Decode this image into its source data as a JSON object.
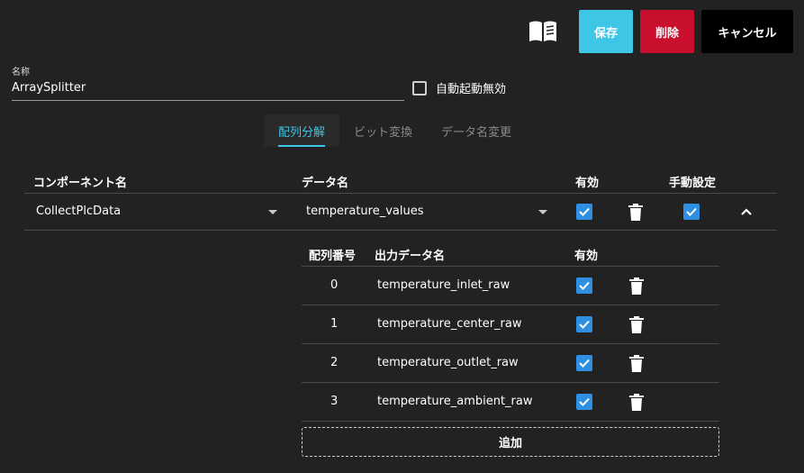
{
  "toolbar": {
    "manual_icon": "book-icon",
    "save_label": "保存",
    "delete_label": "削除",
    "cancel_label": "キャンセル"
  },
  "form": {
    "name_label": "名称",
    "name_value": "ArraySplitter",
    "autostart_label": "自動起動無効",
    "autostart_checked": false
  },
  "tabs": [
    {
      "label": "配列分解",
      "active": true
    },
    {
      "label": "ビット変換",
      "active": false
    },
    {
      "label": "データ名変更",
      "active": false
    }
  ],
  "table": {
    "headers": {
      "component": "コンポーネント名",
      "data": "データ名",
      "enabled": "有効",
      "manual": "手動設定"
    },
    "row": {
      "component": "CollectPlcData",
      "data": "temperature_values",
      "enabled": true,
      "manual": true,
      "expanded": true
    }
  },
  "subtable": {
    "headers": {
      "index": "配列番号",
      "output": "出力データ名",
      "enabled": "有効"
    },
    "rows": [
      {
        "index": "0",
        "output": "temperature_inlet_raw",
        "enabled": true
      },
      {
        "index": "1",
        "output": "temperature_center_raw",
        "enabled": true
      },
      {
        "index": "2",
        "output": "temperature_outlet_raw",
        "enabled": true
      },
      {
        "index": "3",
        "output": "temperature_ambient_raw",
        "enabled": true
      }
    ],
    "add_label": "追加"
  },
  "colors": {
    "accent": "#3ec6e6",
    "danger": "#c8102e",
    "checkbox": "#2e8fe3",
    "background": "#222222"
  }
}
